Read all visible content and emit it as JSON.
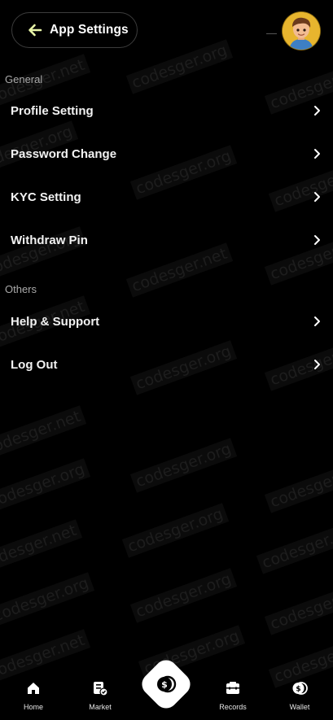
{
  "header": {
    "title": "App Settings"
  },
  "sections": {
    "general": {
      "title": "General",
      "items": [
        {
          "label": "Profile Setting"
        },
        {
          "label": "Password Change"
        },
        {
          "label": "KYC Setting"
        },
        {
          "label": "Withdraw Pin"
        }
      ]
    },
    "others": {
      "title": "Others",
      "items": [
        {
          "label": "Help & Support"
        },
        {
          "label": "Log Out"
        }
      ]
    }
  },
  "bottom_nav": {
    "items": [
      {
        "label": "Home",
        "icon": "home-icon"
      },
      {
        "label": "Market",
        "icon": "market-icon"
      },
      {
        "label": "Records",
        "icon": "records-icon"
      },
      {
        "label": "Wallet",
        "icon": "wallet-icon"
      }
    ],
    "center_icon": "dollar-coin-icon"
  },
  "watermark": {
    "texts": [
      "codesger.net",
      "codesger.org"
    ]
  },
  "colors": {
    "background": "#000000",
    "accent_arrow": "#e9f5a8",
    "avatar_bg": "#e7b52e"
  }
}
